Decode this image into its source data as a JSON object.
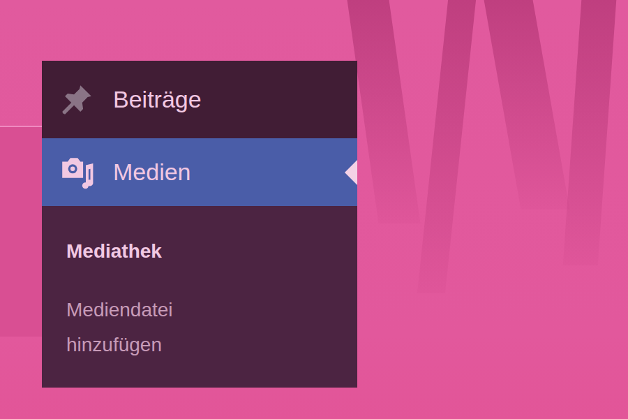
{
  "menu": {
    "items": [
      {
        "label": "Beiträge",
        "icon": "pin",
        "selected": false
      },
      {
        "label": "Medien",
        "icon": "media",
        "selected": true
      }
    ],
    "submenu": [
      {
        "label": "Mediathek",
        "selected": true
      },
      {
        "label": "Mediendatei hinzufügen",
        "selected": false
      }
    ]
  }
}
